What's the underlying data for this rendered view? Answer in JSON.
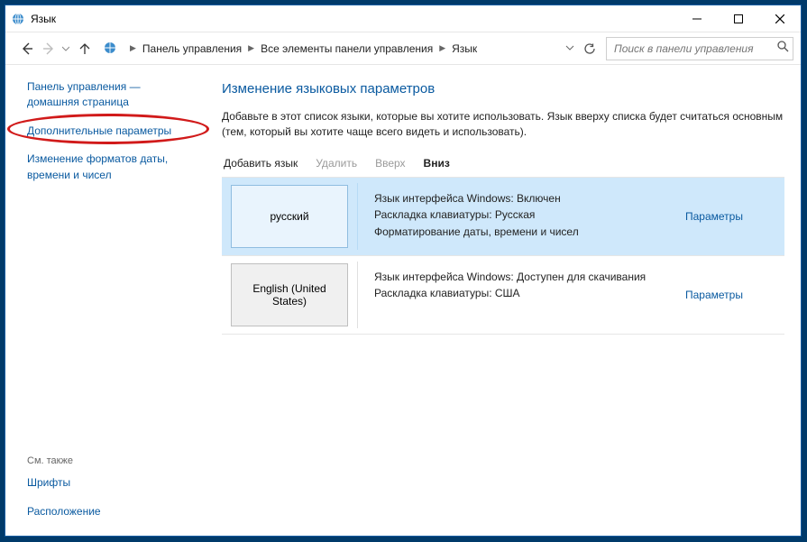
{
  "window": {
    "title": "Язык"
  },
  "breadcrumbs": {
    "root": "Панель управления",
    "mid": "Все элементы панели управления",
    "leaf": "Язык"
  },
  "search": {
    "placeholder": "Поиск в панели управления"
  },
  "sidebar": {
    "home": "Панель управления — домашняя страница",
    "advanced": "Дополнительные параметры",
    "formats": "Изменение форматов даты, времени и чисел",
    "see_also_heading": "См. также",
    "fonts": "Шрифты",
    "location": "Расположение"
  },
  "content": {
    "heading": "Изменение языковых параметров",
    "description": "Добавьте в этот список языки, которые вы хотите использовать. Язык вверху списка будет считаться основным (тем, который вы хотите чаще всего видеть и использовать)."
  },
  "toolbar": {
    "add": "Добавить язык",
    "remove": "Удалить",
    "up": "Вверх",
    "down": "Вниз"
  },
  "languages": [
    {
      "name": "русский",
      "line1": "Язык интерфейса Windows: Включен",
      "line2": "Раскладка клавиатуры: Русская",
      "line3": "Форматирование даты, времени и чисел",
      "options": "Параметры",
      "selected": true
    },
    {
      "name": "English (United States)",
      "line1": "Язык интерфейса Windows: Доступен для скачивания",
      "line2": "Раскладка клавиатуры: США",
      "line3": "",
      "options": "Параметры",
      "selected": false
    }
  ]
}
